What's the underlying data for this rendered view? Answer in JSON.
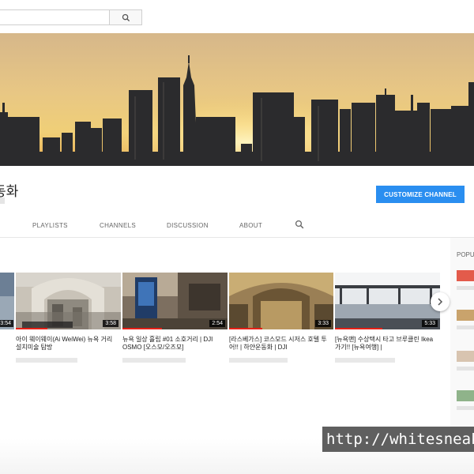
{
  "search": {
    "value": "",
    "placeholder": ""
  },
  "icons": {
    "search": "search-icon",
    "next": "chevron-right-icon"
  },
  "channel": {
    "name": "동화"
  },
  "header": {
    "customize_label": "CUSTOMIZE CHANNEL"
  },
  "tabs": [
    {
      "label": "PLAYLISTS"
    },
    {
      "label": "CHANNELS"
    },
    {
      "label": "DISCUSSION"
    },
    {
      "label": "ABOUT"
    }
  ],
  "sidebar": {
    "title": "POPU"
  },
  "videos": [
    {
      "duration": "3:54",
      "title": ""
    },
    {
      "duration": "3:58",
      "title": "아이 웨이웨이(Ai WeiWei) 뉴욕 거리 설치미술 탐방"
    },
    {
      "duration": "2:54",
      "title": "뉴욕 일상 흘립 #01 소호거리 | DJI OSMO [오스모/오즈모]"
    },
    {
      "duration": "3:33",
      "title": "[라스베가스] 코스모드 시저스 호텔 투어!! | 하얀운동화 | DJI"
    },
    {
      "duration": "5:33",
      "title": "[뉴욕맨] 수상택시 타고 브루클린 Ikea 가기!! [뉴욕여행] |"
    }
  ],
  "colors": {
    "accent": "#2a8ef0",
    "progress": "#e62117"
  },
  "watermark": "http://whitesneaker"
}
